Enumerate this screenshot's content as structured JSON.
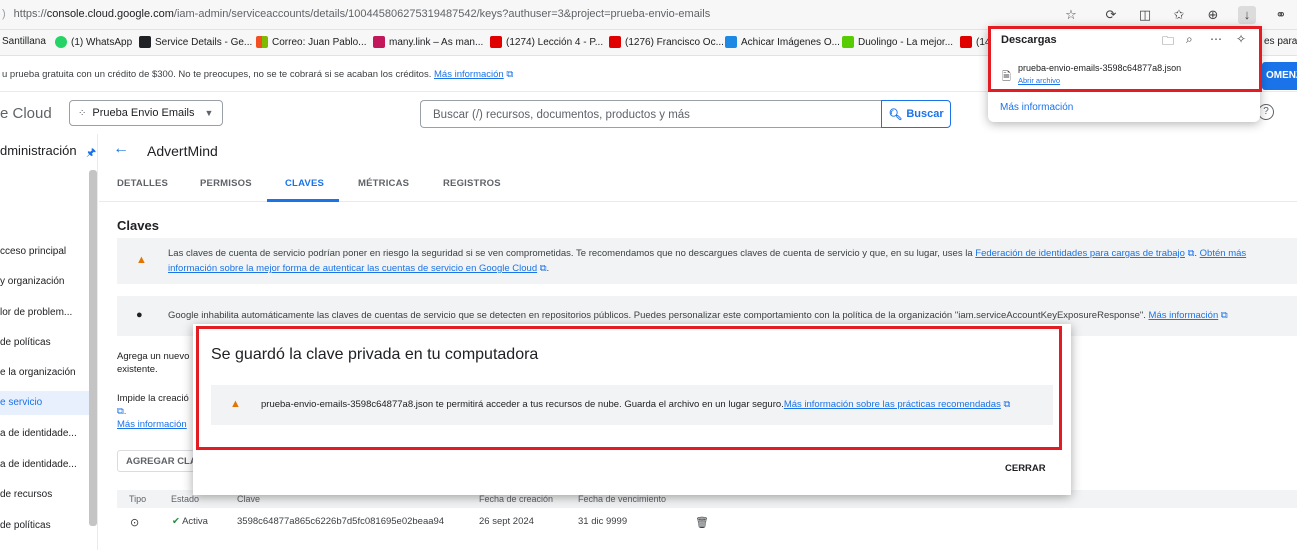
{
  "browser": {
    "url_prefix": ")",
    "url_scheme": "https://",
    "url_host": "console.cloud.google.com",
    "url_path": "/iam-admin/serviceaccounts/details/100445806275319487542/keys?authuser=3&project=prueba-envio-emails"
  },
  "bookmarks": [
    {
      "label": "Santillana",
      "color": "#ffffff"
    },
    {
      "label": "(1) WhatsApp",
      "color": "#25d366"
    },
    {
      "label": "Service Details - Ge...",
      "color": "#202124"
    },
    {
      "label": "Correo: Juan Pablo...",
      "color": "#f25022"
    },
    {
      "label": "many.link – As man...",
      "color": "#c2185b"
    },
    {
      "label": "(1274) Lección 4 - P...",
      "color": "#e00000"
    },
    {
      "label": "(1276) Francisco Oc...",
      "color": "#e00000"
    },
    {
      "label": "Achicar Imágenes O...",
      "color": "#1e88e5"
    },
    {
      "label": "Duolingo - La mejor...",
      "color": "#58cc02"
    },
    {
      "label": "(14",
      "color": "#e00000"
    }
  ],
  "bookmarks_tail": "es para...",
  "trial": {
    "text": "u prueba gratuita con un crédito de $300. No te preocupes, no se te cobrará si se acaban los créditos.",
    "link": "Más información",
    "activate_label": "OMENZA"
  },
  "header": {
    "logo_text": "e Cloud",
    "project_name": "Prueba Envio Emails",
    "search_placeholder": "Buscar (/) recursos, documentos, productos y más",
    "search_button": "Buscar",
    "help_glyph": "?"
  },
  "sidebar": {
    "title": "dministración",
    "items": [
      {
        "label": "cceso principal",
        "active": false
      },
      {
        "label": "y organización",
        "active": false
      },
      {
        "label": "lor de problem...",
        "active": false
      },
      {
        "label": "de políticas",
        "active": false
      },
      {
        "label": "e la organización",
        "active": false
      },
      {
        "label": "e servicio",
        "active": true
      },
      {
        "label": "a de identidade...",
        "active": false
      },
      {
        "label": "a de identidade...",
        "active": false
      },
      {
        "label": "de recursos",
        "active": false
      },
      {
        "label": "de políticas",
        "active": false
      }
    ]
  },
  "account": {
    "title": "AdvertMind"
  },
  "tabs": [
    {
      "label": "DETALLES",
      "active": false
    },
    {
      "label": "PERMISOS",
      "active": false
    },
    {
      "label": "CLAVES",
      "active": true
    },
    {
      "label": "MÉTRICAS",
      "active": false
    },
    {
      "label": "REGISTROS",
      "active": false
    }
  ],
  "keys": {
    "section_title": "Claves",
    "warning_text_1": "Las claves de cuenta de servicio podrían poner en riesgo la seguridad si se ven comprometidas. Te recomendamos que no descargues claves de cuenta de servicio y que, en su lugar, uses la",
    "warning_link_1": "Federación de identidades para cargas de trabajo",
    "warning_link_2a": "Obtén más",
    "warning_link_2b": "información sobre la mejor forma de autenticar las cuentas de servicio en Google Cloud",
    "info_text": "Google inhabilita automáticamente las claves de cuentas de servicio que se detecten en repositorios públicos. Puedes personalizar este comportamiento con la política de la organización \"iam.serviceAccountKeyExposureResponse\".",
    "info_link": "Más información",
    "frag_1a": "Agrega un nuevo",
    "frag_1b": "existente.",
    "frag_2a": "Impide la creació",
    "frag_2b": "",
    "frag_2c": "Más información",
    "add_key_button": "AGREGAR CLAVE",
    "columns": [
      "Tipo",
      "Estado",
      "Clave",
      "Fecha de creación",
      "Fecha de vencimiento"
    ],
    "rows": [
      {
        "status": "Activa",
        "key": "3598c64877a865c6226b7d5fc081695e02beaa94",
        "created": "26 sept 2024",
        "expires": "31 dic 9999"
      }
    ]
  },
  "dialog": {
    "title": "Se guardó la clave privada en tu computadora",
    "message": "prueba-envio-emails-3598c64877a8.json te permitirá acceder a tus recursos de nube. Guarda el archivo en un lugar seguro.",
    "link": "Más información sobre las prácticas recomendadas",
    "close_button": "CERRAR"
  },
  "downloads": {
    "title": "Descargas",
    "file_name": "prueba-envio-emails-3598c64877a8.json",
    "open_link": "Abrir archivo",
    "more_info": "Más información"
  },
  "colors": {
    "accent": "#1a73e8",
    "highlight": "#e31b23",
    "warning": "#e37400",
    "success": "#1e8e3e"
  }
}
